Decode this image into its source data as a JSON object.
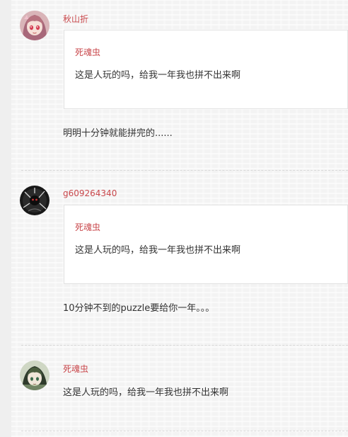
{
  "comments": [
    {
      "author": "秋山折",
      "avatar_icon": "anime-girl-avatar",
      "quote": {
        "author": "死魂虫",
        "text": "这是人玩的吗，给我一年我也拼不出来啊"
      },
      "text": "明明十分钟就能拼完的......"
    },
    {
      "author": "g609264340",
      "avatar_icon": "dark-figure-avatar",
      "quote": {
        "author": "死魂虫",
        "text": "这是人玩的吗，给我一年我也拼不出来啊"
      },
      "text": "10分钟不到的puzzle要给你一年。。。"
    },
    {
      "author": "死魂虫",
      "avatar_icon": "green-character-avatar",
      "text": "这是人玩的吗，给我一年我也拼不出来啊"
    }
  ],
  "colors": {
    "author_link": "#c9474b",
    "body_text": "#333333",
    "quote_bg": "#ffffff",
    "quote_border": "#e2e2e2",
    "divider": "#d9d9d9"
  }
}
